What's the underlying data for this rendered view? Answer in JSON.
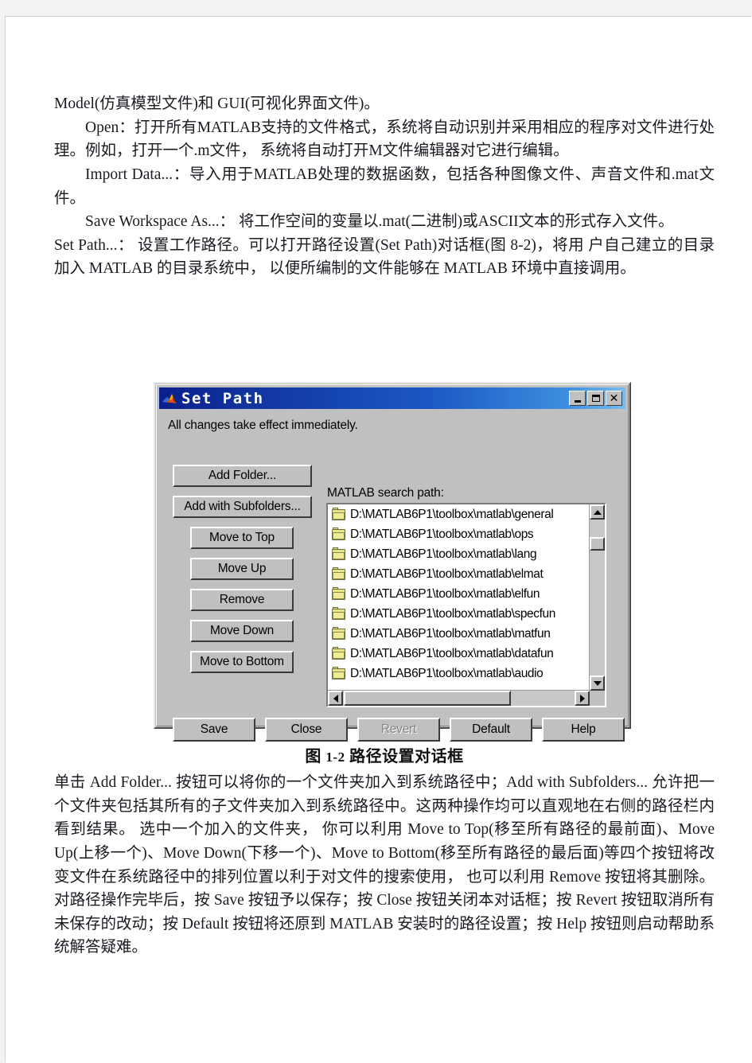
{
  "document": {
    "paragraphs": [
      "Model(仿真模型文件)和 GUI(可视化界面文件)。",
      "Open：打开所有MATLAB支持的文件格式，系统将自动识别并采用相应的程序对文件进行处理。例如，打开一个.m文件， 系统将自动打开M文件编辑器对它进行编辑。",
      "Import Data...：导入用于MATLAB处理的数据函数，包括各种图像文件、声音文件和.mat文件。",
      "Save Workspace As...： 将工作空间的变量以.mat(二进制)或ASCII文本的形式存入文件。",
      "Set Path...： 设置工作路径。可以打开路径设置(Set Path)对话框(图 8-2)，将用 户自己建立的目录加入 MATLAB 的目录系统中， 以便所编制的文件能够在 MATLAB 环境中直接调用。"
    ],
    "figure_caption_label": "图",
    "figure_caption_number": "1-2",
    "figure_caption_title": "路径设置对话框",
    "closing_paragraph": "单击 Add Folder... 按钮可以将你的一个文件夹加入到系统路径中；Add with Subfolders... 允许把一个文件夹包括其所有的子文件夹加入到系统路径中。这两种操作均可以直观地在右侧的路径栏内看到结果。 选中一个加入的文件夹， 你可以利用 Move to Top(移至所有路径的最前面)、Move Up(上移一个)、Move Down(下移一个)、Move to Bottom(移至所有路径的最后面)等四个按钮将改变文件在系统路径中的排列位置以利于对文件的搜索使用， 也可以利用 Remove 按钮将其删除。对路径操作完毕后，按 Save 按钮予以保存；按 Close 按钮关闭本对话框；按 Revert 按钮取消所有未保存的改动；按 Default 按钮将还原到 MATLAB 安装时的路径设置；按 Help 按钮则启动帮助系统解答疑难。"
  },
  "dialog": {
    "title": "Set Path",
    "app_icon": "matlab-membrane-icon",
    "subtitle": "All changes take effect immediately.",
    "window_controls": {
      "minimize": "minimize-icon",
      "maximize": "maximize-icon",
      "close": "close-icon"
    },
    "left_buttons": [
      {
        "label": "Add Folder...",
        "size": "wide",
        "enabled": true
      },
      {
        "label": "Add with Subfolders...",
        "size": "wide",
        "enabled": true
      },
      {
        "label": "Move to Top",
        "size": "narrow",
        "enabled": true
      },
      {
        "label": "Move Up",
        "size": "narrow",
        "enabled": true
      },
      {
        "label": "Remove",
        "size": "narrow",
        "enabled": true
      },
      {
        "label": "Move Down",
        "size": "narrow",
        "enabled": true
      },
      {
        "label": "Move to Bottom",
        "size": "narrow",
        "enabled": true
      }
    ],
    "list_label": "MATLAB search path:",
    "paths": [
      "D:\\MATLAB6P1\\toolbox\\matlab\\general",
      "D:\\MATLAB6P1\\toolbox\\matlab\\ops",
      "D:\\MATLAB6P1\\toolbox\\matlab\\lang",
      "D:\\MATLAB6P1\\toolbox\\matlab\\elmat",
      "D:\\MATLAB6P1\\toolbox\\matlab\\elfun",
      "D:\\MATLAB6P1\\toolbox\\matlab\\specfun",
      "D:\\MATLAB6P1\\toolbox\\matlab\\matfun",
      "D:\\MATLAB6P1\\toolbox\\matlab\\datafun",
      "D:\\MATLAB6P1\\toolbox\\matlab\\audio"
    ],
    "bottom_buttons": [
      {
        "label": "Save",
        "enabled": true
      },
      {
        "label": "Close",
        "enabled": true
      },
      {
        "label": "Revert",
        "enabled": false
      },
      {
        "label": "Default",
        "enabled": true
      },
      {
        "label": "Help",
        "enabled": true
      }
    ],
    "colors": {
      "face": "#c0c0c0",
      "titlebar_start": "#0a1f8c",
      "titlebar_end": "#77bdf0",
      "folder_icon": "#e8e48a",
      "list_background": "#ffffff",
      "disabled_text": "#868686"
    }
  }
}
